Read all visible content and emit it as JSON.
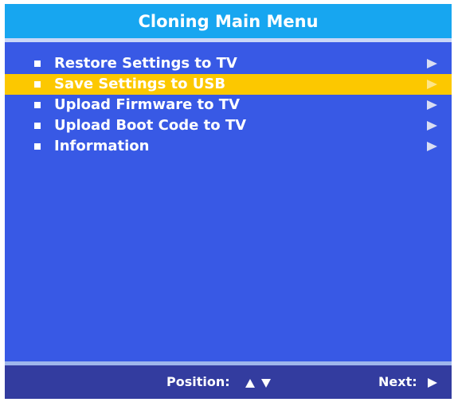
{
  "header": {
    "title": "Cloning Main Menu"
  },
  "menu": {
    "items": [
      {
        "label": "Restore Settings to TV",
        "selected": false,
        "icon": "arrow-right-icon"
      },
      {
        "label": "Save Settings to USB",
        "selected": true,
        "icon": "arrow-right-icon"
      },
      {
        "label": "Upload Firmware to TV",
        "selected": false,
        "icon": "arrow-right-icon"
      },
      {
        "label": "Upload Boot Code to TV",
        "selected": false,
        "icon": "arrow-right-icon"
      },
      {
        "label": "Information",
        "selected": false,
        "icon": "arrow-right-icon"
      }
    ]
  },
  "footer": {
    "position_label": "Position:",
    "position_icons": [
      "up-arrow-icon",
      "down-arrow-icon"
    ],
    "next_label": "Next:",
    "next_icon": "right-arrow-icon"
  },
  "colors": {
    "background": "#3859e5",
    "title_bar": "#17a6f0",
    "highlight": "#fcc800",
    "footer": "#333c9f",
    "text": "#ffffff"
  }
}
